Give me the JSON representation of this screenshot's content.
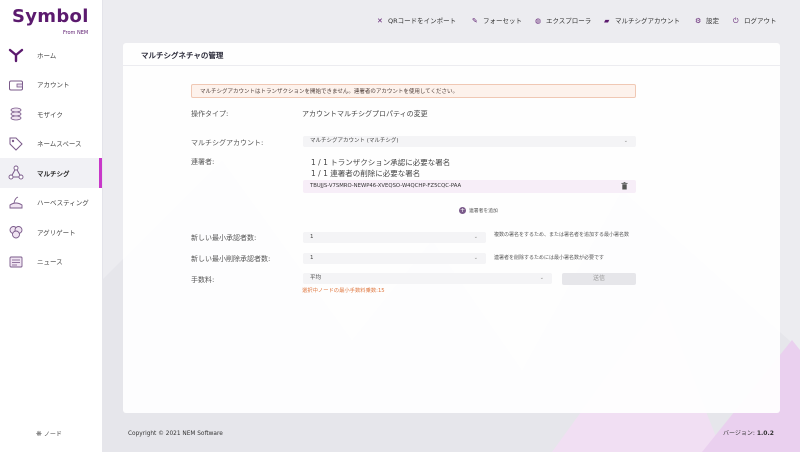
{
  "brand": {
    "name": "Symbol",
    "sub": "From NEM"
  },
  "sidebar": {
    "items": [
      {
        "label": "ホーム",
        "icon": "home-icon"
      },
      {
        "label": "アカウント",
        "icon": "wallet-icon"
      },
      {
        "label": "モザイク",
        "icon": "coins-icon"
      },
      {
        "label": "ネームスペース",
        "icon": "tag-icon"
      },
      {
        "label": "マルチシグ",
        "icon": "multisig-icon",
        "active": true
      },
      {
        "label": "ハーベスティング",
        "icon": "harvest-icon"
      },
      {
        "label": "アグリゲート",
        "icon": "aggregate-icon"
      },
      {
        "label": "ニュース",
        "icon": "news-icon"
      }
    ],
    "node_label": "ノード"
  },
  "topbar": {
    "import_qr": "QRコードをインポート",
    "faucet": "フォーセット",
    "explorer": "エクスプローラ",
    "multisig_account": "マルチシグアカウント",
    "settings": "設定",
    "logout": "ログアウト"
  },
  "page": {
    "title": "マルチシグネチャの管理",
    "warning": "マルチシグアカウントはトランザクションを開始できません。連署者のアカウントを使用してください。",
    "operation_type_label": "操作タイプ:",
    "operation_type_value": "アカウントマルチシグプロパティの変更",
    "multisig_account_label": "マルチシグアカウント:",
    "multisig_account_value": "マルチシグアカウント (マルチシグ)",
    "cosigners_label": "連署者:",
    "cosigners_info_1": "1 / 1 トランザクション承認に必要な署名",
    "cosigners_info_2": "1 / 1 連署者の削除に必要な署名",
    "cosigner_address": "TBUJJS-V7SMRO-NEWP46-XVEQSO-W4QCHP-FZ5CQC-PAA",
    "add_cosigner": "連署者を追加",
    "min_approval_label": "新しい最小承認者数:",
    "min_approval_value": "1",
    "min_approval_hint": "複数の署名をするため、または署名者を追加する最小署名数",
    "min_removal_label": "新しい最小削除承認者数:",
    "min_removal_value": "1",
    "min_removal_hint": "連署者を削除するためには最小署名数が必要です",
    "fee_label": "手数料:",
    "fee_value": "平均",
    "fee_note": "選択中ノードの最小手数料乗数:15",
    "send_button": "送信"
  },
  "footer": {
    "copyright": "Copyright © 2021 NEM Software",
    "version_label": "バージョン: ",
    "version_value": "1.0.2"
  },
  "colors": {
    "brand": "#5b1a6e",
    "accent": "#c837c9",
    "warning_bg": "#fdf2ec",
    "fee_note": "#e07840"
  }
}
